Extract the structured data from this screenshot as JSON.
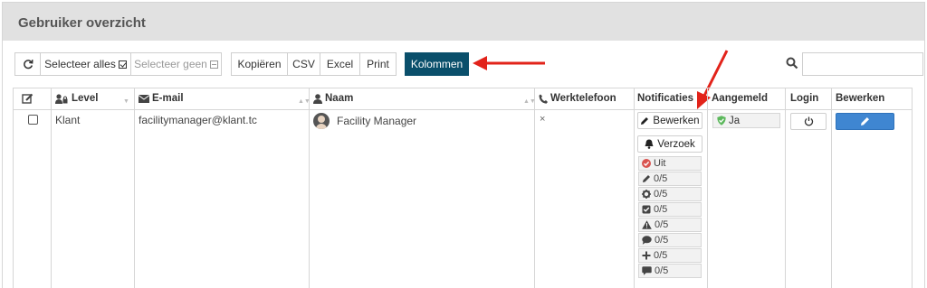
{
  "panel": {
    "title": "Gebruiker overzicht"
  },
  "toolbar": {
    "refresh_icon": "refresh-icon",
    "select_all_label": "Selecteer alles",
    "select_none_label": "Selecteer geen",
    "copy_label": "Kopiëren",
    "csv_label": "CSV",
    "excel_label": "Excel",
    "print_label": "Print",
    "columns_label": "Kolommen",
    "search_placeholder": ""
  },
  "table": {
    "headers": {
      "level": "Level",
      "email": "E-mail",
      "name": "Naam",
      "work_phone": "Werktelefoon",
      "notifications": "Notificaties",
      "logged_in": "Aangemeld",
      "login": "Login",
      "edit": "Bewerken"
    },
    "rows": [
      {
        "level": "Klant",
        "email": "facilitymanager@klant.tc",
        "name": "Facility Manager",
        "work_phone": "×",
        "notif_edit_label": "Bewerken",
        "notif_request_label": "Verzoek",
        "notif_items": [
          {
            "icon": "status-off-icon",
            "text": "Uit"
          },
          {
            "icon": "pencil-icon",
            "text": "0/5"
          },
          {
            "icon": "gear-icon",
            "text": "0/5"
          },
          {
            "icon": "checkbox-icon",
            "text": "0/5"
          },
          {
            "icon": "warning-icon",
            "text": "0/5"
          },
          {
            "icon": "comment-icon",
            "text": "0/5"
          },
          {
            "icon": "plus-icon",
            "text": "0/5"
          },
          {
            "icon": "message-icon",
            "text": "0/5"
          }
        ],
        "logged_in": "Ja"
      }
    ]
  },
  "colors": {
    "primary_button": "#0a4f6b",
    "edit_button": "#3f86d1",
    "annotation_arrow": "#e2231a",
    "status_off": "#d9534f",
    "status_ok": "#5cb85c"
  }
}
